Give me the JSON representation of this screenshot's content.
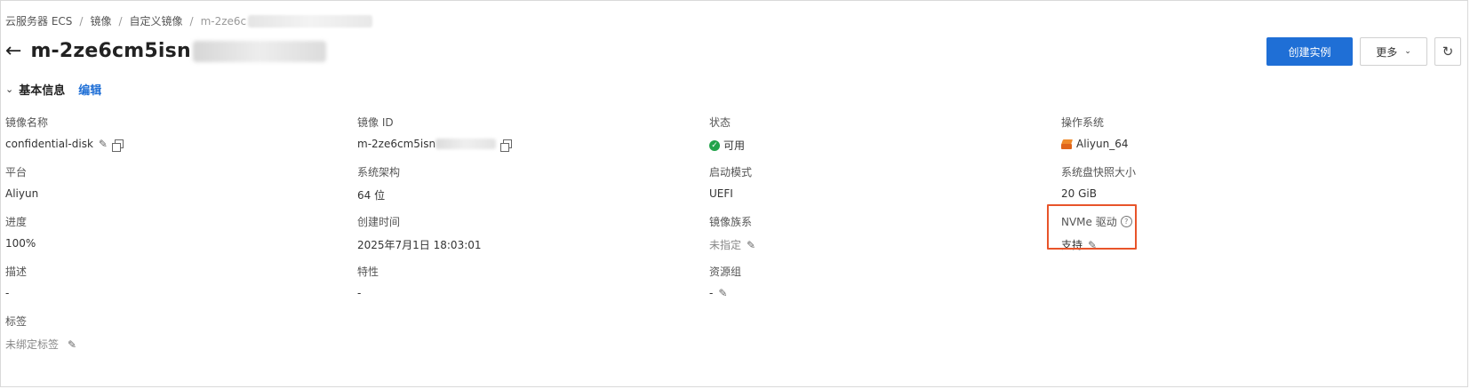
{
  "breadcrumb": {
    "items": [
      "云服务器 ECS",
      "镜像",
      "自定义镜像"
    ],
    "current": "m-2ze6c"
  },
  "header": {
    "title": "m-2ze6cm5isn",
    "buttons": {
      "create_instance": "创建实例",
      "more": "更多",
      "refresh_icon": "refresh-icon"
    }
  },
  "section": {
    "title": "基本信息",
    "edit": "编辑"
  },
  "fields": {
    "image_name": {
      "label": "镜像名称",
      "value": "confidential-disk"
    },
    "image_id": {
      "label": "镜像 ID",
      "value": "m-2ze6cm5isn"
    },
    "status": {
      "label": "状态",
      "value": "可用"
    },
    "os": {
      "label": "操作系统",
      "value": "Aliyun_64"
    },
    "platform": {
      "label": "平台",
      "value": "Aliyun"
    },
    "arch": {
      "label": "系统架构",
      "value": "64 位"
    },
    "boot_mode": {
      "label": "启动模式",
      "value": "UEFI"
    },
    "snapshot_size": {
      "label": "系统盘快照大小",
      "value": "20 GiB"
    },
    "progress": {
      "label": "进度",
      "value": "100%"
    },
    "created": {
      "label": "创建时间",
      "value": "2025年7月1日 18:03:01"
    },
    "family": {
      "label": "镜像族系",
      "value": "未指定"
    },
    "nvme": {
      "label": "NVMe 驱动",
      "value": "支持"
    },
    "description": {
      "label": "描述",
      "value": "-"
    },
    "features": {
      "label": "特性",
      "value": "-"
    },
    "resource_group": {
      "label": "资源组",
      "value": "-"
    },
    "tags": {
      "label": "标签",
      "value": "未绑定标签"
    }
  },
  "colors": {
    "primary": "#1f6fd6",
    "success": "#22a34a",
    "highlight": "#e8542a"
  }
}
